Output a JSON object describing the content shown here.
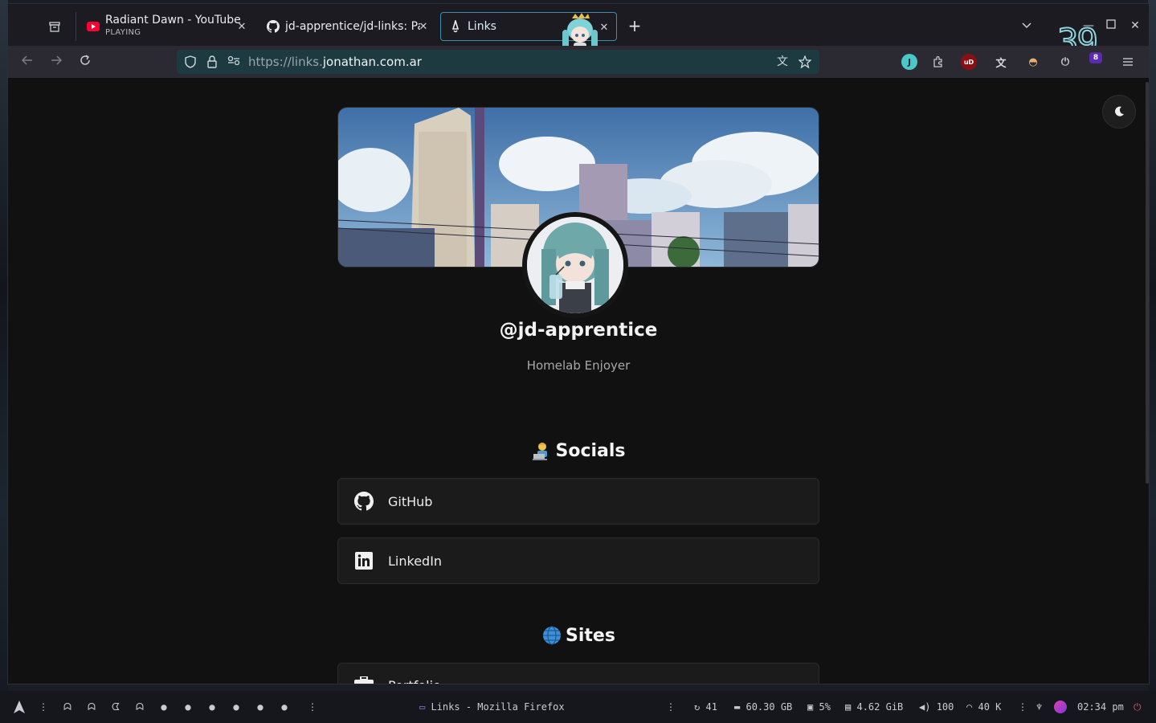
{
  "tabs": [
    {
      "title": "Radiant Dawn - YouTube",
      "subtitle": "PLAYING",
      "favicon": "youtube-icon"
    },
    {
      "title": "jd-apprentice/jd-links: Pa",
      "subtitle": "",
      "favicon": "github-icon"
    },
    {
      "title": "Links",
      "subtitle": "",
      "favicon": "astro-icon",
      "active": true
    }
  ],
  "url": {
    "scheme_sub": "https://links.",
    "host": "jonathan.com.ar"
  },
  "clock_overlay": "39",
  "extension_badge": "8",
  "profile": {
    "handle": "@jd-apprentice",
    "bio": "Homelab Enjoyer"
  },
  "sections": [
    {
      "title": "Socials",
      "emoji": "technologist-emoji",
      "links": [
        {
          "label": "GitHub",
          "icon": "github-icon"
        },
        {
          "label": "LinkedIn",
          "icon": "linkedin-icon"
        }
      ]
    },
    {
      "title": "Sites",
      "emoji": "globe-emoji",
      "links": [
        {
          "label": "Portfolio",
          "icon": "briefcase-icon"
        }
      ]
    }
  ],
  "taskbar": {
    "window_title": "Links - Mozilla Firefox",
    "updates": "41",
    "disk": "60.30 GB",
    "cpu": "5%",
    "memory": "4.62 GiB",
    "volume": "100",
    "network": "40 K",
    "time": "02:34 pm"
  },
  "colors": {
    "accent": "#3a8fb0",
    "page_bg": "#111111",
    "card_bg": "#1b1b1b"
  }
}
